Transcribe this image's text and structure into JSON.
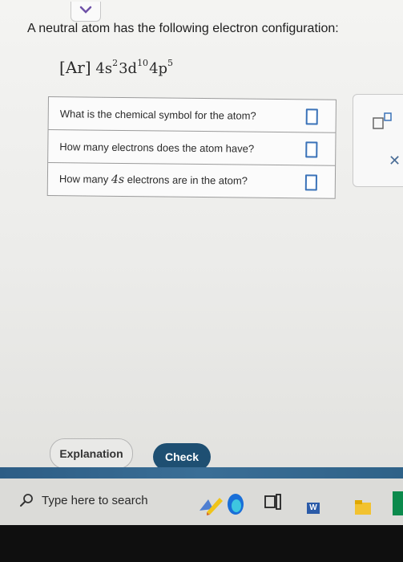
{
  "question": {
    "intro": "A neutral atom has the following electron configuration:",
    "config": {
      "core": "Ar",
      "terms": [
        {
          "base": "4s",
          "exp": "2"
        },
        {
          "base": "3d",
          "exp": "10"
        },
        {
          "base": "4p",
          "exp": "5"
        }
      ]
    }
  },
  "table": {
    "rows": [
      {
        "label": "What is the chemical symbol for the atom?",
        "value": ""
      },
      {
        "label_pre": "How many electrons does the atom have?",
        "value": ""
      },
      {
        "label_pre": "How many ",
        "label_ital": "4s",
        "label_post": " electrons are in the atom?",
        "value": ""
      }
    ]
  },
  "buttons": {
    "explanation": "Explanation",
    "check": "Check"
  },
  "taskbar": {
    "search_placeholder": "Type here to search",
    "word_label": "W"
  },
  "colors": {
    "accent": "#3a72b8",
    "check_button": "#1e4f72",
    "bezel": "#2d5d85"
  }
}
